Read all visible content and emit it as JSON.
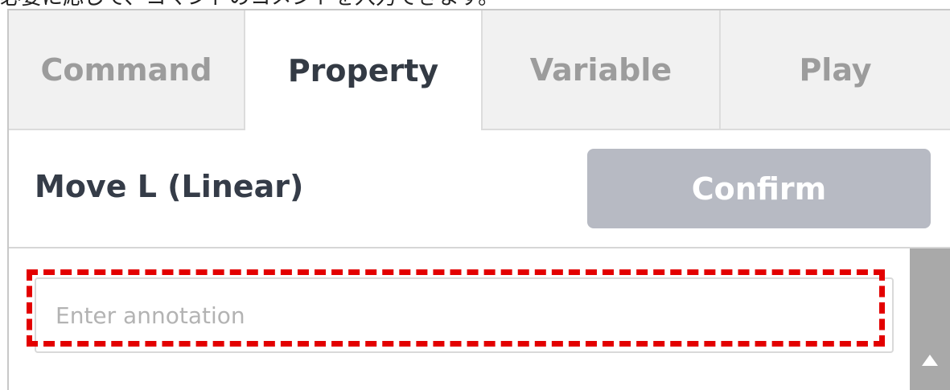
{
  "caption": "必要に応じて、コマンドのコメントを入力できます。",
  "tabs": [
    {
      "label": "Command"
    },
    {
      "label": "Property"
    },
    {
      "label": "Variable"
    },
    {
      "label": "Play"
    }
  ],
  "active_tab": "Property",
  "header": {
    "command_title": "Move L (Linear)",
    "confirm_label": "Confirm"
  },
  "annotation": {
    "placeholder": "Enter annotation",
    "value": ""
  },
  "colors": {
    "highlight": "#e30000",
    "confirm_button_bg": "#b7bac3",
    "inactive_tab_bg": "#f1f1f1",
    "scrollbar": "#a9a9a9"
  },
  "icons": {
    "scroll_up": "triangle-up-icon"
  }
}
